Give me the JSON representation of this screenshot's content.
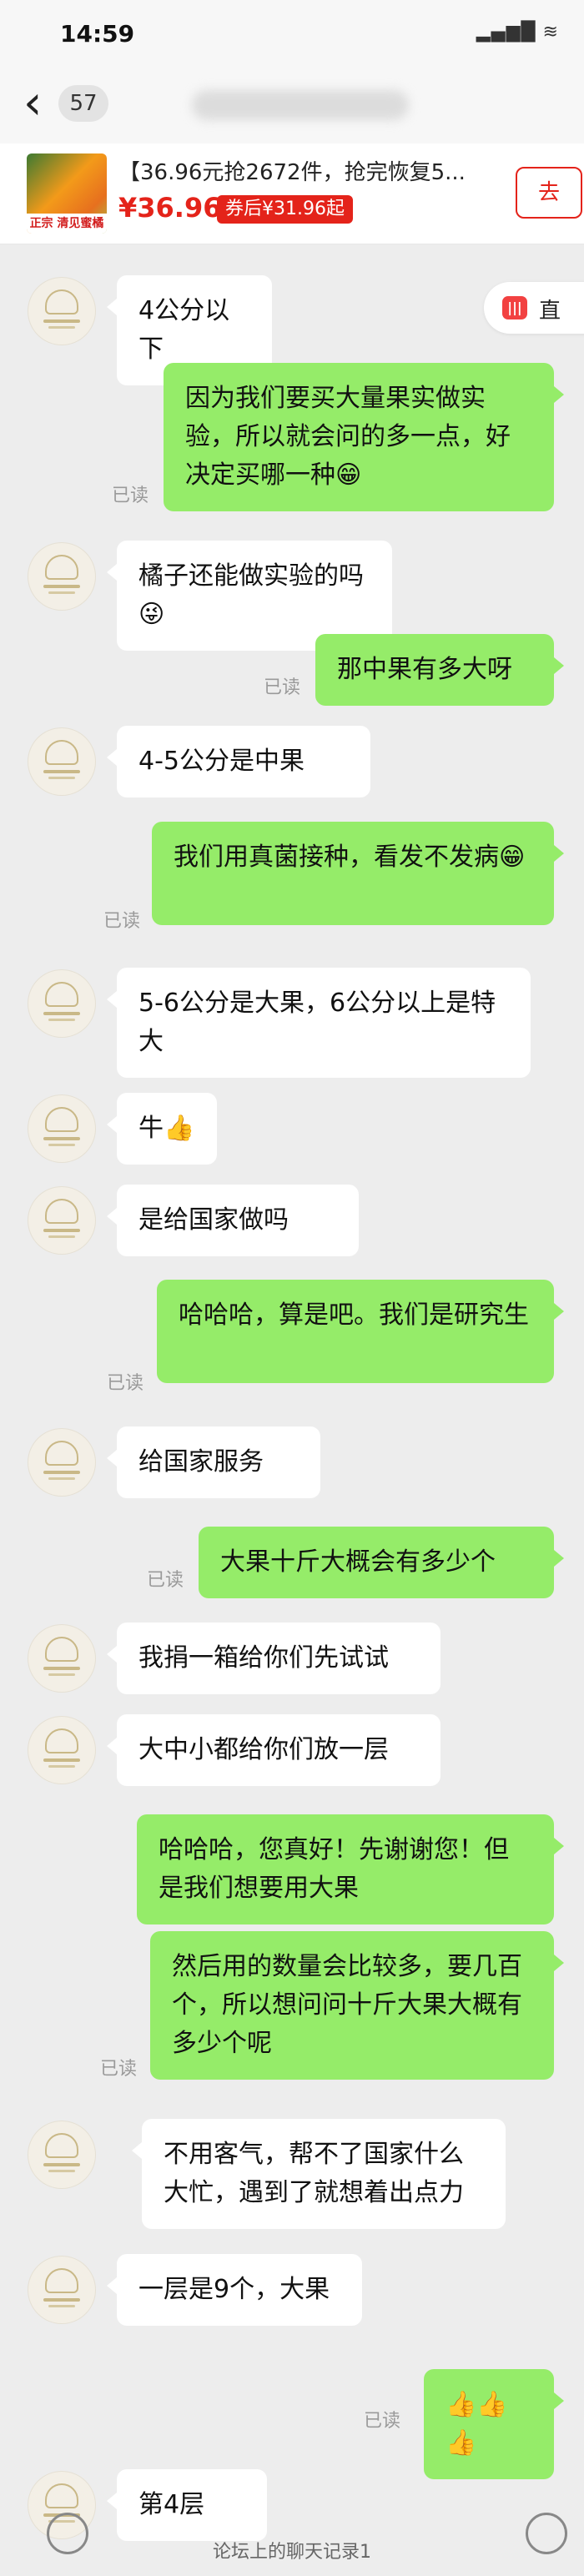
{
  "status_bar": {
    "time": "14:59",
    "signal": "▂▄▆█ ≋"
  },
  "nav": {
    "back": "‹",
    "unread_count": "57"
  },
  "product": {
    "title": "【36.96元抢2672件，抢完恢复5...",
    "price": "¥36.96",
    "coupon": "券后¥31.96起",
    "goto": "去",
    "thumb_label": "正宗 清见蜜橘"
  },
  "floating": {
    "icon": "|||",
    "label": "直"
  },
  "messages": [
    {
      "from": "in",
      "text": "4公分以下"
    },
    {
      "from": "out",
      "text": "因为我们要买大量果实做实验，所以就会问的多一点，好决定买哪一种😁",
      "status": "已读"
    },
    {
      "from": "in",
      "text": "橘子还能做实验的吗😜"
    },
    {
      "from": "out",
      "text": "那中果有多大呀",
      "status": "已读"
    },
    {
      "from": "in",
      "text": "4-5公分是中果"
    },
    {
      "from": "out",
      "text": "我们用真菌接种，看发不发病😁",
      "status": "已读"
    },
    {
      "from": "in",
      "text": "5-6公分是大果，6公分以上是特大"
    },
    {
      "from": "in",
      "text": "牛👍"
    },
    {
      "from": "in",
      "text": "是给国家做吗"
    },
    {
      "from": "out",
      "text": "哈哈哈，算是吧。我们是研究生",
      "status": "已读"
    },
    {
      "from": "in",
      "text": "给国家服务"
    },
    {
      "from": "out",
      "text": "大果十斤大概会有多少个",
      "status": "已读"
    },
    {
      "from": "in",
      "text": "我捐一箱给你们先试试"
    },
    {
      "from": "in",
      "text": "大中小都给你们放一层"
    },
    {
      "from": "out",
      "text": "哈哈哈，您真好！先谢谢您！但是我们想要用大果"
    },
    {
      "from": "out",
      "text": "然后用的数量会比较多，要几百个，所以想问问十斤大果大概有多少个呢",
      "status": "已读"
    },
    {
      "from": "in",
      "text": "不用客气，帮不了国家什么大忙，遇到了就想着出点力"
    },
    {
      "from": "in",
      "text": "一层是9个，大果"
    },
    {
      "from": "out",
      "text": "👍👍👍",
      "status": "已读"
    },
    {
      "from": "in",
      "text": "第4层"
    }
  ],
  "footer": {
    "caption": "论坛上的聊天记录1"
  }
}
